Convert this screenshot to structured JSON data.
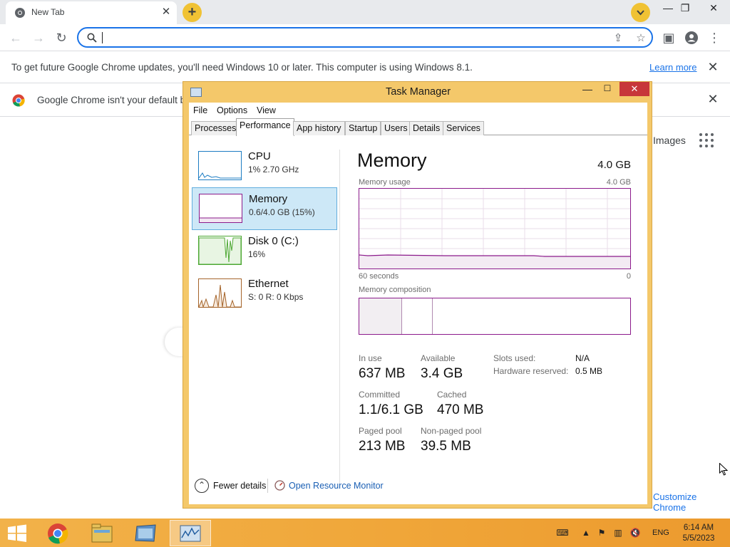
{
  "browser": {
    "tab_title": "New Tab",
    "tab_close": "✕",
    "new_tab": "+",
    "omnibox_value": "",
    "window_minimize": "—",
    "window_restore": "❐",
    "window_close": "✕"
  },
  "infobar": {
    "message": "To get future Google Chrome updates, you'll need Windows 10 or later. This computer is using Windows 8.1.",
    "link": "Learn more",
    "close": "✕"
  },
  "default_browser_bar": {
    "message": "Google Chrome isn't your default browser",
    "close": "✕"
  },
  "ntp": {
    "images_link": "Images",
    "customize_link": "Customize Chrome"
  },
  "task_manager": {
    "title": "Task Manager",
    "close": "✕",
    "menu": [
      "File",
      "Options",
      "View"
    ],
    "tabs": [
      "Processes",
      "Performance",
      "App history",
      "Startup",
      "Users",
      "Details",
      "Services"
    ],
    "active_tab": "Performance",
    "sidebar": [
      {
        "name": "CPU",
        "detail": "1%  2.70 GHz"
      },
      {
        "name": "Memory",
        "detail": "0.6/4.0 GB (15%)"
      },
      {
        "name": "Disk 0 (C:)",
        "detail": "16%"
      },
      {
        "name": "Ethernet",
        "detail": "S: 0  R: 0 Kbps"
      }
    ],
    "memory": {
      "title": "Memory",
      "total": "4.0 GB",
      "usage_label": "Memory usage",
      "usage_max": "4.0 GB",
      "time_label": "60 seconds",
      "time_end": "0",
      "composition_label": "Memory composition",
      "stats": {
        "in_use_label": "In use",
        "in_use": "637 MB",
        "available_label": "Available",
        "available": "3.4 GB",
        "committed_label": "Committed",
        "committed": "1.1/6.1 GB",
        "cached_label": "Cached",
        "cached": "470 MB",
        "paged_label": "Paged pool",
        "paged": "213 MB",
        "nonpaged_label": "Non-paged pool",
        "nonpaged": "39.5 MB",
        "slots_label": "Slots used:",
        "slots": "N/A",
        "hw_reserved_label": "Hardware reserved:",
        "hw_reserved": "0.5 MB"
      }
    },
    "footer": {
      "fewer_details": "Fewer details",
      "resource_monitor": "Open Resource Monitor"
    }
  },
  "taskbar": {
    "language": "ENG",
    "time": "6:14 AM",
    "date": "5/5/2023"
  },
  "colors": {
    "accent_blue": "#1a73e8",
    "tm_frame": "#f4c86a",
    "memory_purple": "#8b1a8b",
    "taskbar": "#f0a73a"
  }
}
